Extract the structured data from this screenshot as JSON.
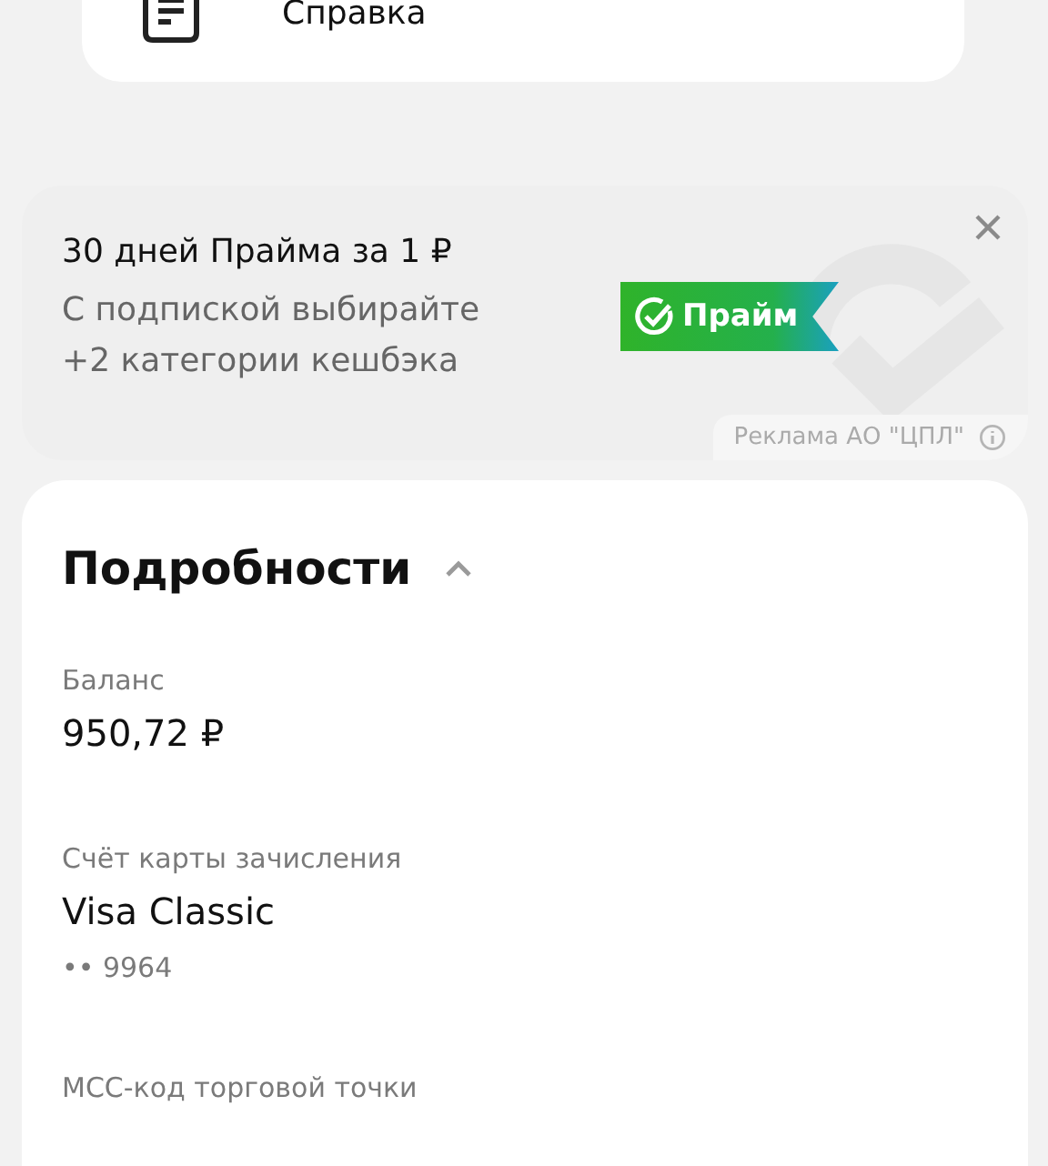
{
  "menu_card": {
    "items": [
      {
        "label": "Справка"
      }
    ]
  },
  "ad": {
    "title": "30 дней Прайма за 1 ₽",
    "text_lines": [
      "С подпиской выбирайте",
      "+2 категории кешбэка"
    ],
    "badge": "Прайм",
    "disclaimer": "Реклама АО \"ЦПЛ\""
  },
  "details": {
    "title": "Подробности",
    "expanded": true,
    "fields": [
      {
        "label": "Баланс",
        "value": "950,72 ₽"
      },
      {
        "label": "Счёт карты зачисления",
        "value": "Visa Classic",
        "sub": "•• 9964"
      },
      {
        "label": "МСС-код торговой точки"
      }
    ]
  }
}
